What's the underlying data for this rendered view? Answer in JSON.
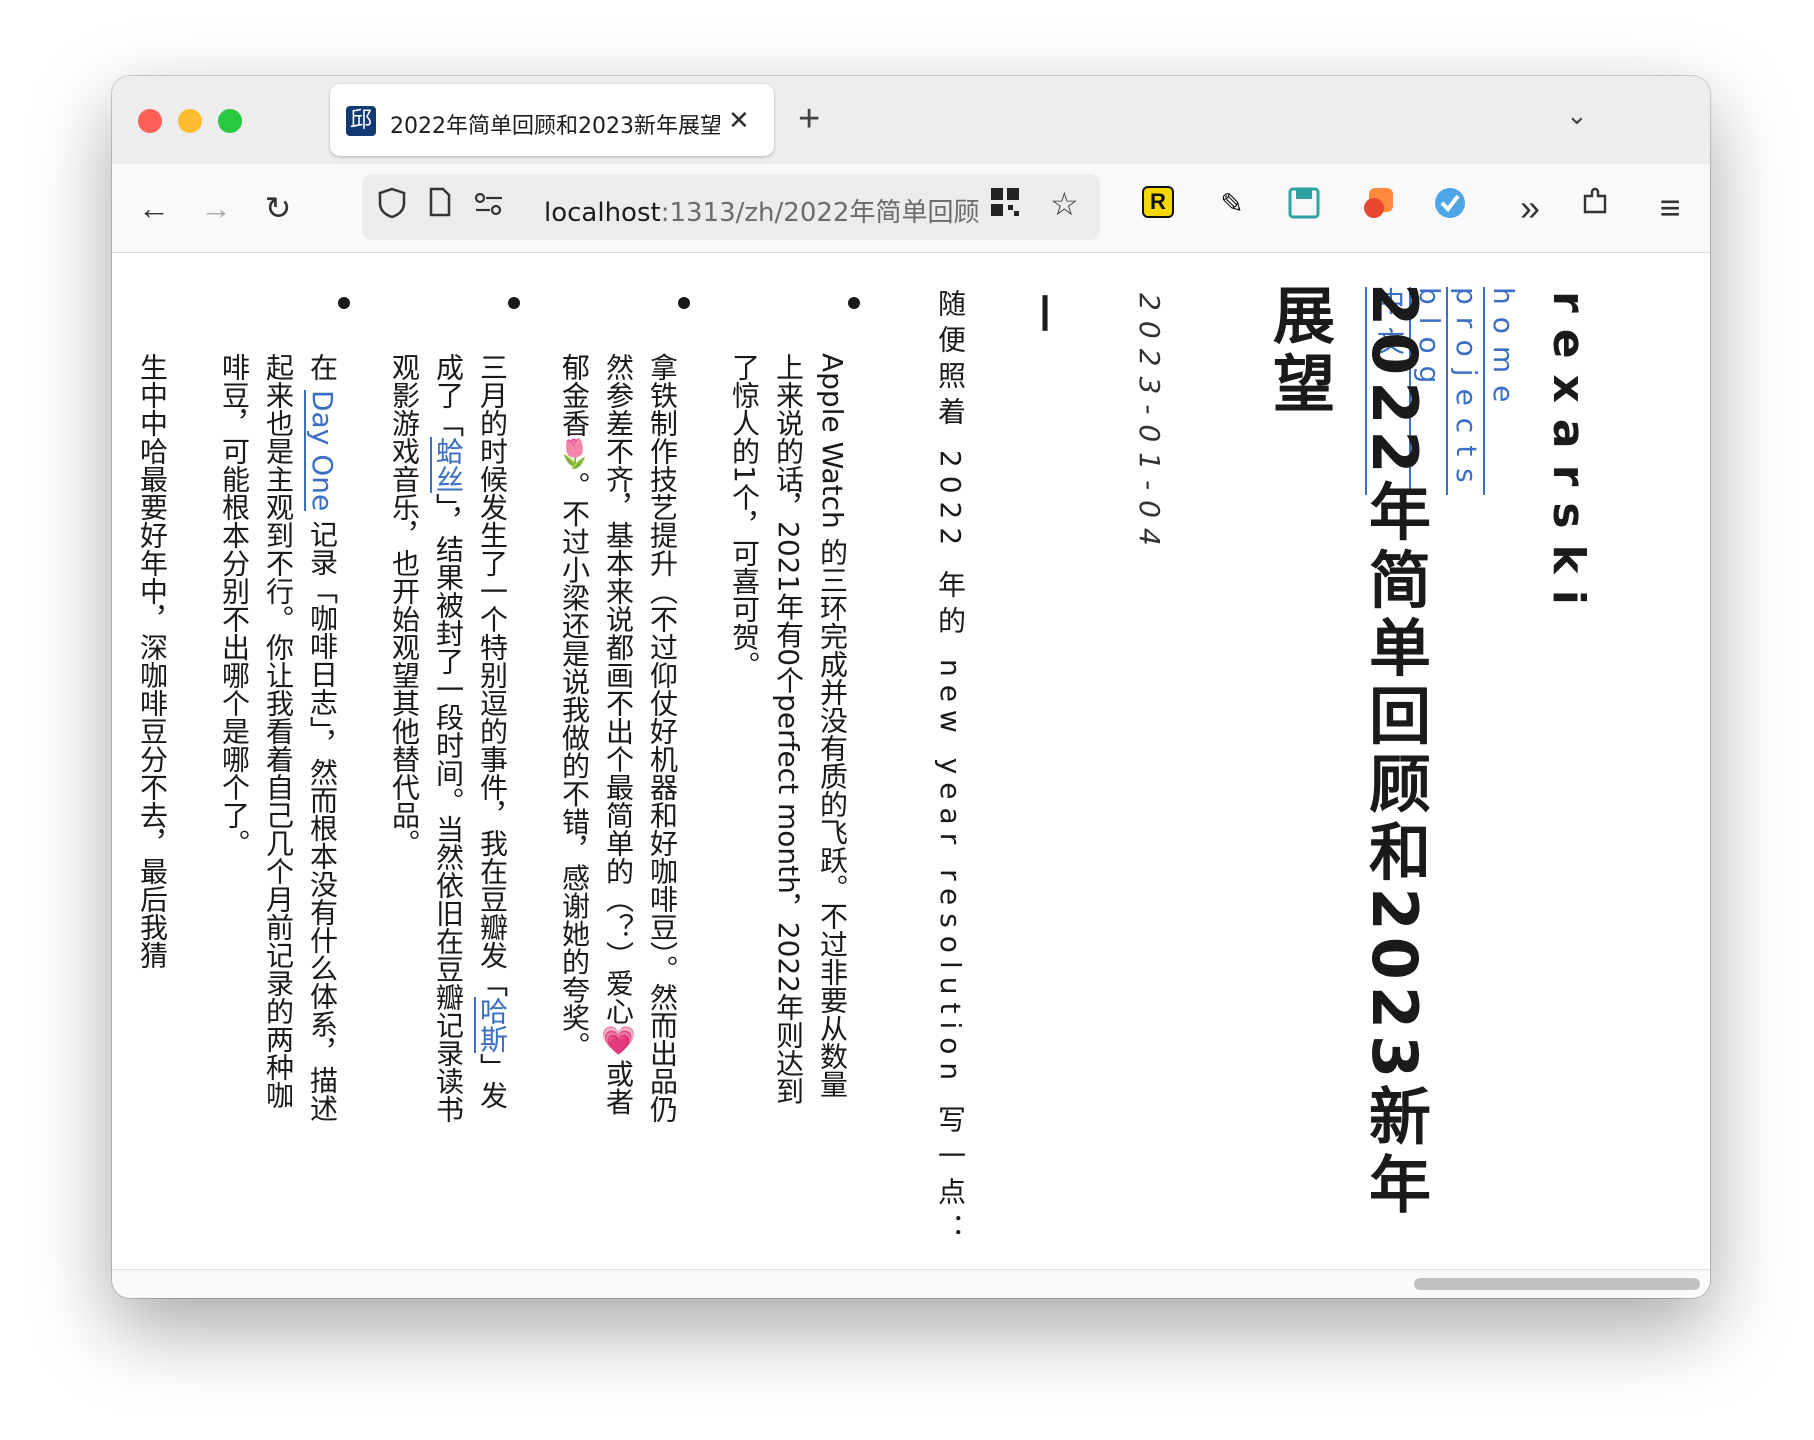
{
  "browser": {
    "tab_title": "2022年简单回顾和2023新年展望",
    "favicon_text": "邱",
    "tab_close": "✕",
    "new_tab": "+",
    "tab_list": "⌄",
    "back": "←",
    "forward": "→",
    "reload": "↻",
    "url_host": "localhost",
    "url_rest": ":1313/zh/2022年简单回顾",
    "bookmark_star": "☆",
    "overflow": "»",
    "menu": "≡"
  },
  "site": {
    "logo": "rexarski",
    "nav": [
      "home",
      "projects",
      "blog",
      "中文"
    ]
  },
  "post": {
    "title": "2022年简单回顾和2023新年展望",
    "date": "2023-01-04",
    "dash": "—",
    "intro": "随便照着 2022 年的 new year resolution 写一点：",
    "items": [
      {
        "text": "Apple Watch 的三环完成并没有质的飞跃。不过非要从数量上来说的话，2021年有0个perfect month，2022年则达到了惊人的1个，可喜可贺。"
      },
      {
        "text": "拿铁制作技艺提升（不过仰仗好机器和好咖啡豆）。然而出品仍然参差不齐，基本来说都画不出个最简单的（？）爱心💗或者郁金香🌷。不过小梁还是说我做的不错，感谢她的夸奖。"
      },
      {
        "pre": "三月的时候发生了一个特别逗的事件，我在豆瓣发「",
        "link1": "哈斯",
        "mid": "」发成了「",
        "link2": "蛤丝",
        "post": "」，结果被封了一段时间。当然依旧在豆瓣记录读书观影游戏音乐，也开始观望其他替代品。"
      },
      {
        "pre": "在 ",
        "link1": "Day One",
        "post": " 记录「咖啡日志」，然而根本没有什么体系，描述起来也是主观到不行。你让我看着自己几个月前记录的两种咖啡豆，可能根本分别不出哪个是哪个了。"
      }
    ],
    "partial_last": "生中中哈最要好年中，深咖啡豆分不去，最后我猜"
  }
}
